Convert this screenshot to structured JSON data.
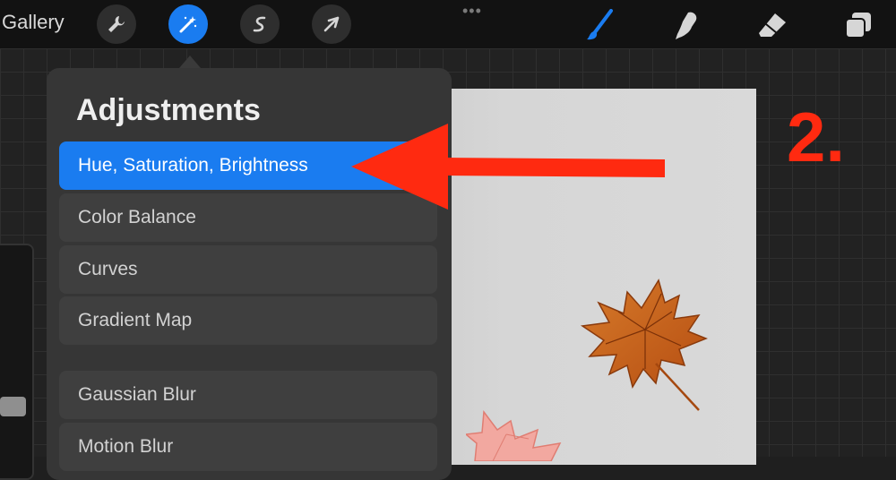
{
  "toolbar": {
    "gallery_label": "Gallery",
    "left_tools": [
      {
        "icon": "wrench-icon",
        "active": false
      },
      {
        "icon": "magic-wand-icon",
        "active": true
      },
      {
        "icon": "s-curve-icon",
        "active": false
      },
      {
        "icon": "cursor-arrow-icon",
        "active": false
      }
    ],
    "more_label": "•••",
    "right_tools": [
      "brush-icon",
      "smudge-icon",
      "eraser-icon",
      "layers-icon"
    ]
  },
  "adjustments": {
    "title": "Adjustments",
    "items": [
      {
        "label": "Hue, Saturation, Brightness",
        "selected": true
      },
      {
        "label": "Color Balance",
        "selected": false
      },
      {
        "label": "Curves",
        "selected": false
      },
      {
        "label": "Gradient Map",
        "selected": false
      },
      {
        "label": "Gaussian Blur",
        "selected": false
      },
      {
        "label": "Motion Blur",
        "selected": false
      }
    ]
  },
  "annotation": {
    "step_label": "2.",
    "color": "#ff2a10"
  },
  "colors": {
    "accent": "#1a7cf0",
    "toolbar_bg": "#121212",
    "popover_bg": "#363636",
    "leaf_orange": "#c9601a"
  }
}
